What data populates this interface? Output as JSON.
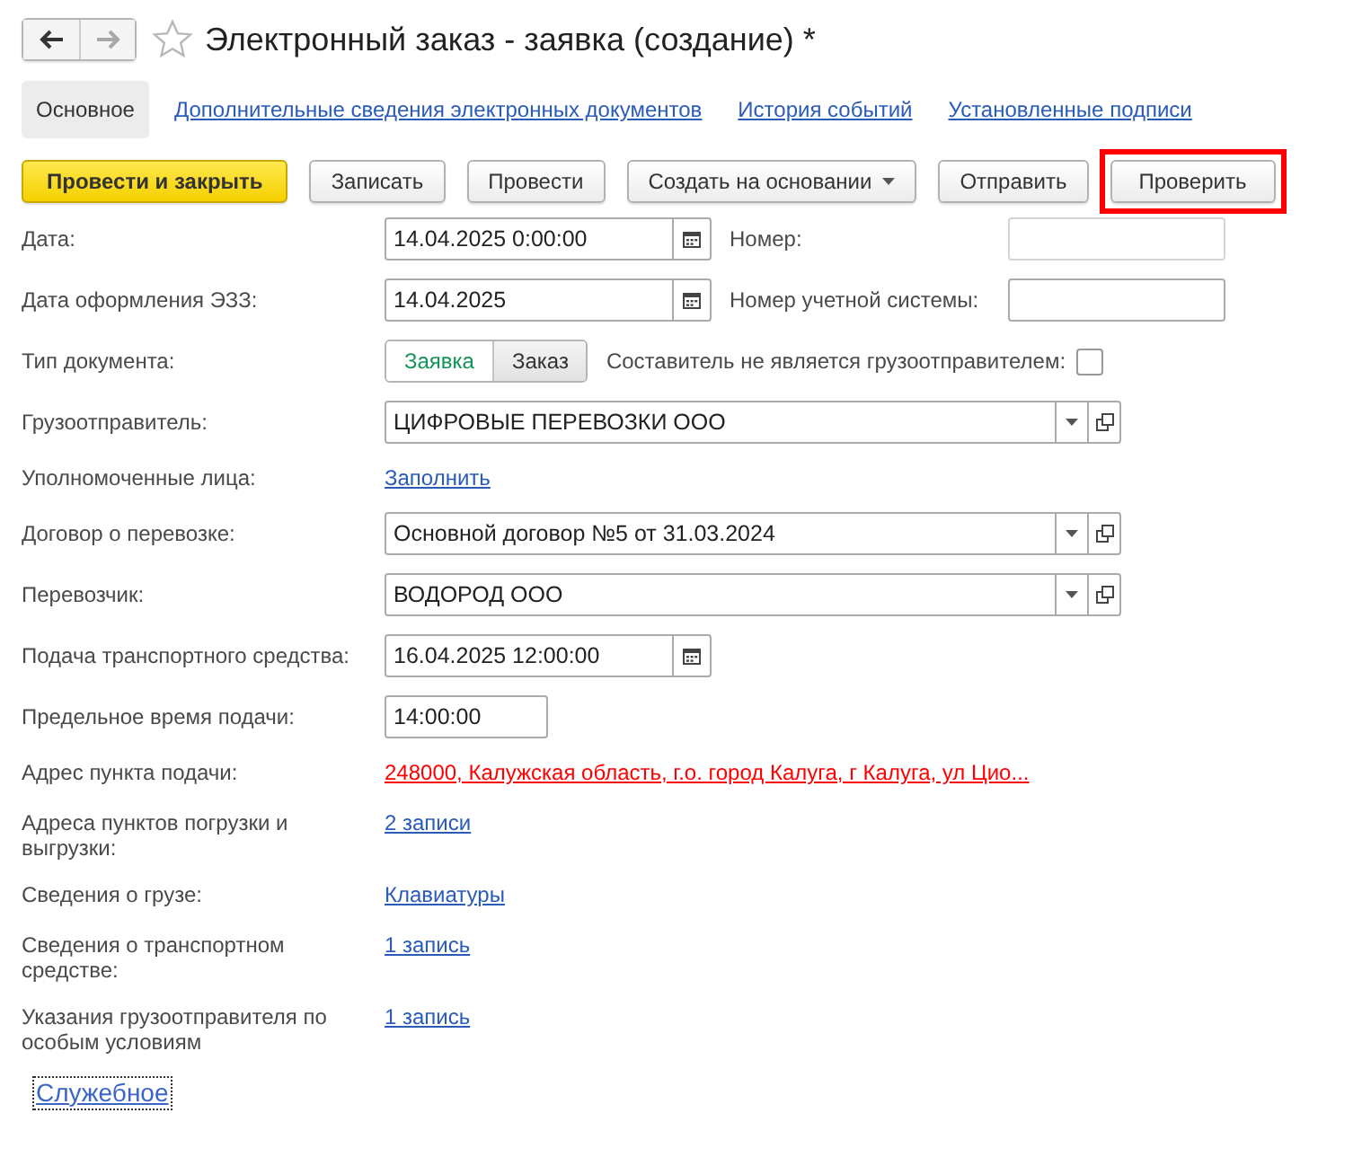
{
  "window": {
    "title": "Электронный заказ - заявка (создание) *",
    "favorite": false
  },
  "nav": [
    {
      "kind": "back",
      "disabled": false
    },
    {
      "kind": "forward",
      "disabled": true
    }
  ],
  "tabs": [
    {
      "label": "Основное",
      "selected": true
    },
    {
      "label": "Дополнительные сведения электронных документов",
      "selected": false
    },
    {
      "label": "История событий",
      "selected": false
    },
    {
      "label": "Установленные подписи",
      "selected": false
    }
  ],
  "toolbar": [
    {
      "label": "Провести и закрыть",
      "kind": "primary",
      "highlighted": false
    },
    {
      "label": "Записать",
      "kind": "normal",
      "highlighted": false
    },
    {
      "label": "Провести",
      "kind": "normal",
      "highlighted": false
    },
    {
      "label": "Создать на основании",
      "kind": "dropdown",
      "highlighted": false
    },
    {
      "label": "Отправить",
      "kind": "normal",
      "highlighted": false
    },
    {
      "label": "Проверить",
      "kind": "normal",
      "highlighted": true
    }
  ],
  "fields": [
    {
      "kind": "datetime",
      "label": "Дата:",
      "value": "14.04.2025  0:00:00",
      "side": {
        "label": "Номер:",
        "disabled": true
      }
    },
    {
      "kind": "datetime",
      "label": "Дата оформления ЭЗЗ:",
      "value": "14.04.2025",
      "side": {
        "label": "Номер учетной системы:",
        "disabled": false
      }
    },
    {
      "kind": "toggle",
      "label": "Тип документа:",
      "options": [
        {
          "label": "Заявка",
          "selected": true
        },
        {
          "label": "Заказ",
          "selected": false
        }
      ],
      "checkbox": {
        "label": "Составитель не является грузоотправителем:",
        "checked": false
      }
    },
    {
      "kind": "select",
      "label": "Грузоотправитель:",
      "value": "ЦИФРОВЫЕ ПЕРЕВОЗКИ ООО"
    },
    {
      "kind": "link",
      "label": "Уполномоченные лица:",
      "value": "Заполнить",
      "error": false
    },
    {
      "kind": "select",
      "label": "Договор о перевозке:",
      "value": "Основной договор №5 от 31.03.2024"
    },
    {
      "kind": "select",
      "label": "Перевозчик:",
      "value": "ВОДОРОД ООО"
    },
    {
      "kind": "datetime",
      "label": "Подача транспортного средства:",
      "value": "16.04.2025 12:00:00"
    },
    {
      "kind": "time",
      "label": "Предельное время подачи:",
      "value": "14:00:00"
    },
    {
      "kind": "link",
      "label": "Адрес пункта подачи:",
      "value": "248000, Калужская область, г.о. город Калуга, г Калуга, ул Цио...",
      "error": true
    },
    {
      "kind": "link",
      "label": "Адреса пунктов погрузки и выгрузки:",
      "value": "2 записи",
      "error": false
    },
    {
      "kind": "link",
      "label": "Сведения о грузе:",
      "value": "Клавиатуры",
      "error": false
    },
    {
      "kind": "link",
      "label": "Сведения о транспортном средстве:",
      "value": "1 запись",
      "error": false
    },
    {
      "kind": "link",
      "label": "Указания грузоотправителя по особым условиям",
      "value": "1 запись",
      "error": false
    }
  ],
  "footer_link": {
    "label": "Служебное",
    "focused": true
  }
}
